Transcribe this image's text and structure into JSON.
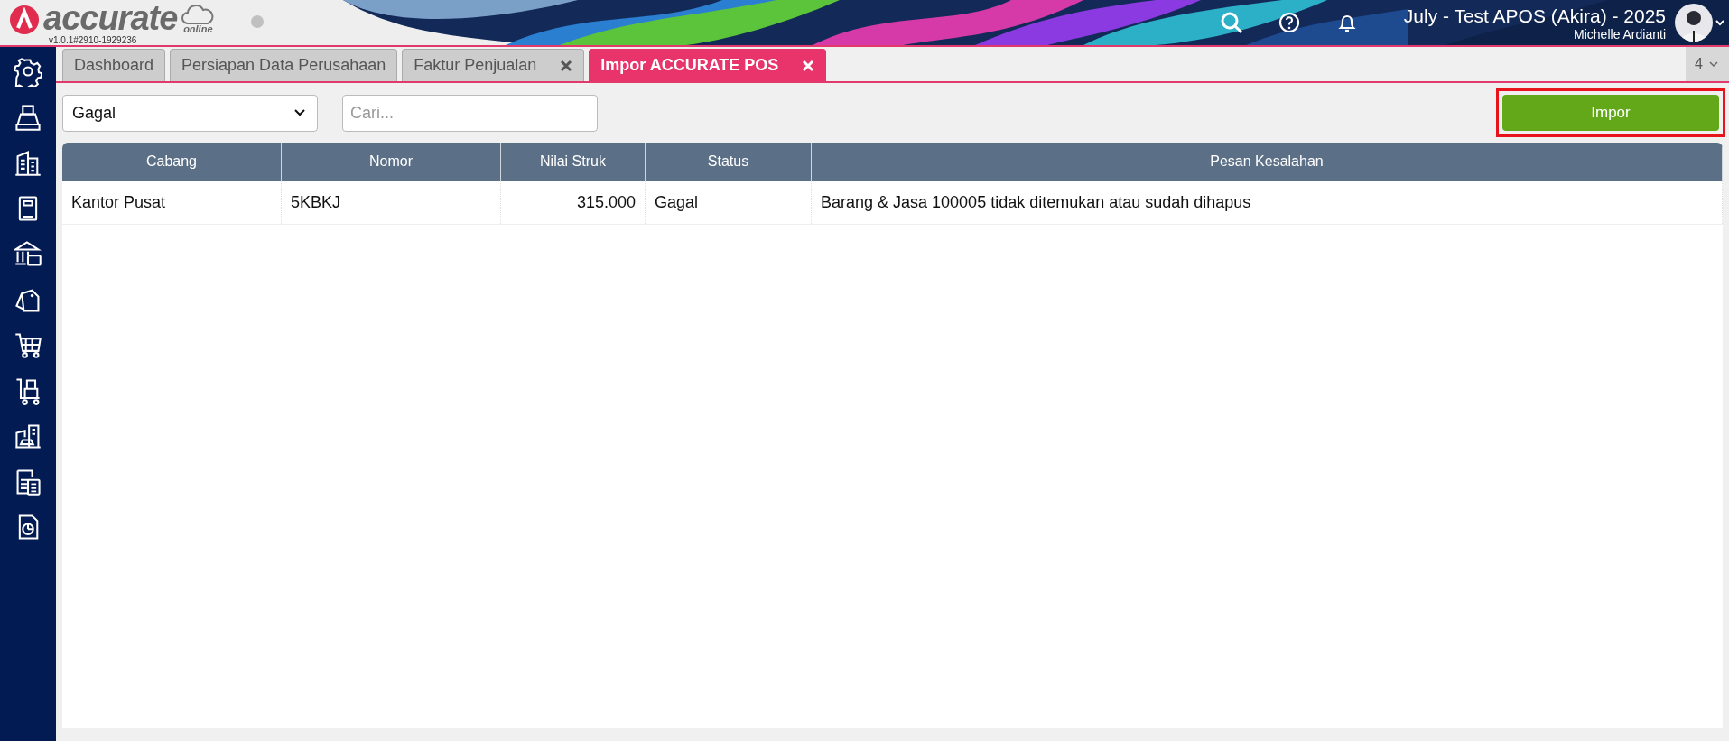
{
  "header": {
    "brand": "accurate",
    "cloud_label": "online",
    "version": "v1.0.1#2910-1929236",
    "company": "July - Test APOS (Akira) - 2025",
    "user": "Michelle Ardianti"
  },
  "tabs": [
    {
      "label": "Dashboard",
      "selected": false,
      "closable": false
    },
    {
      "label": "Persiapan Data Perusahaan",
      "selected": false,
      "closable": false
    },
    {
      "label": "Faktur Penjualan",
      "selected": false,
      "closable": true
    },
    {
      "label": "Impor ACCURATE POS",
      "selected": true,
      "closable": true
    }
  ],
  "tab_count": "4",
  "filter": {
    "value": "Gagal"
  },
  "search": {
    "placeholder": "Cari..."
  },
  "import_button": {
    "label": "Impor",
    "highlighted": true
  },
  "table": {
    "columns": [
      {
        "label": "Cabang",
        "kind": "text"
      },
      {
        "label": "Nomor",
        "kind": "text"
      },
      {
        "label": "Nilai Struk",
        "kind": "number"
      },
      {
        "label": "Status",
        "kind": "text"
      },
      {
        "label": "Pesan Kesalahan",
        "kind": "text"
      }
    ],
    "rows": [
      {
        "cells": [
          "Kantor Pusat",
          "5KBKJ",
          "315.000",
          "Gagal",
          "Barang & Jasa 100005 tidak ditemukan atau sudah dihapus"
        ]
      }
    ]
  }
}
